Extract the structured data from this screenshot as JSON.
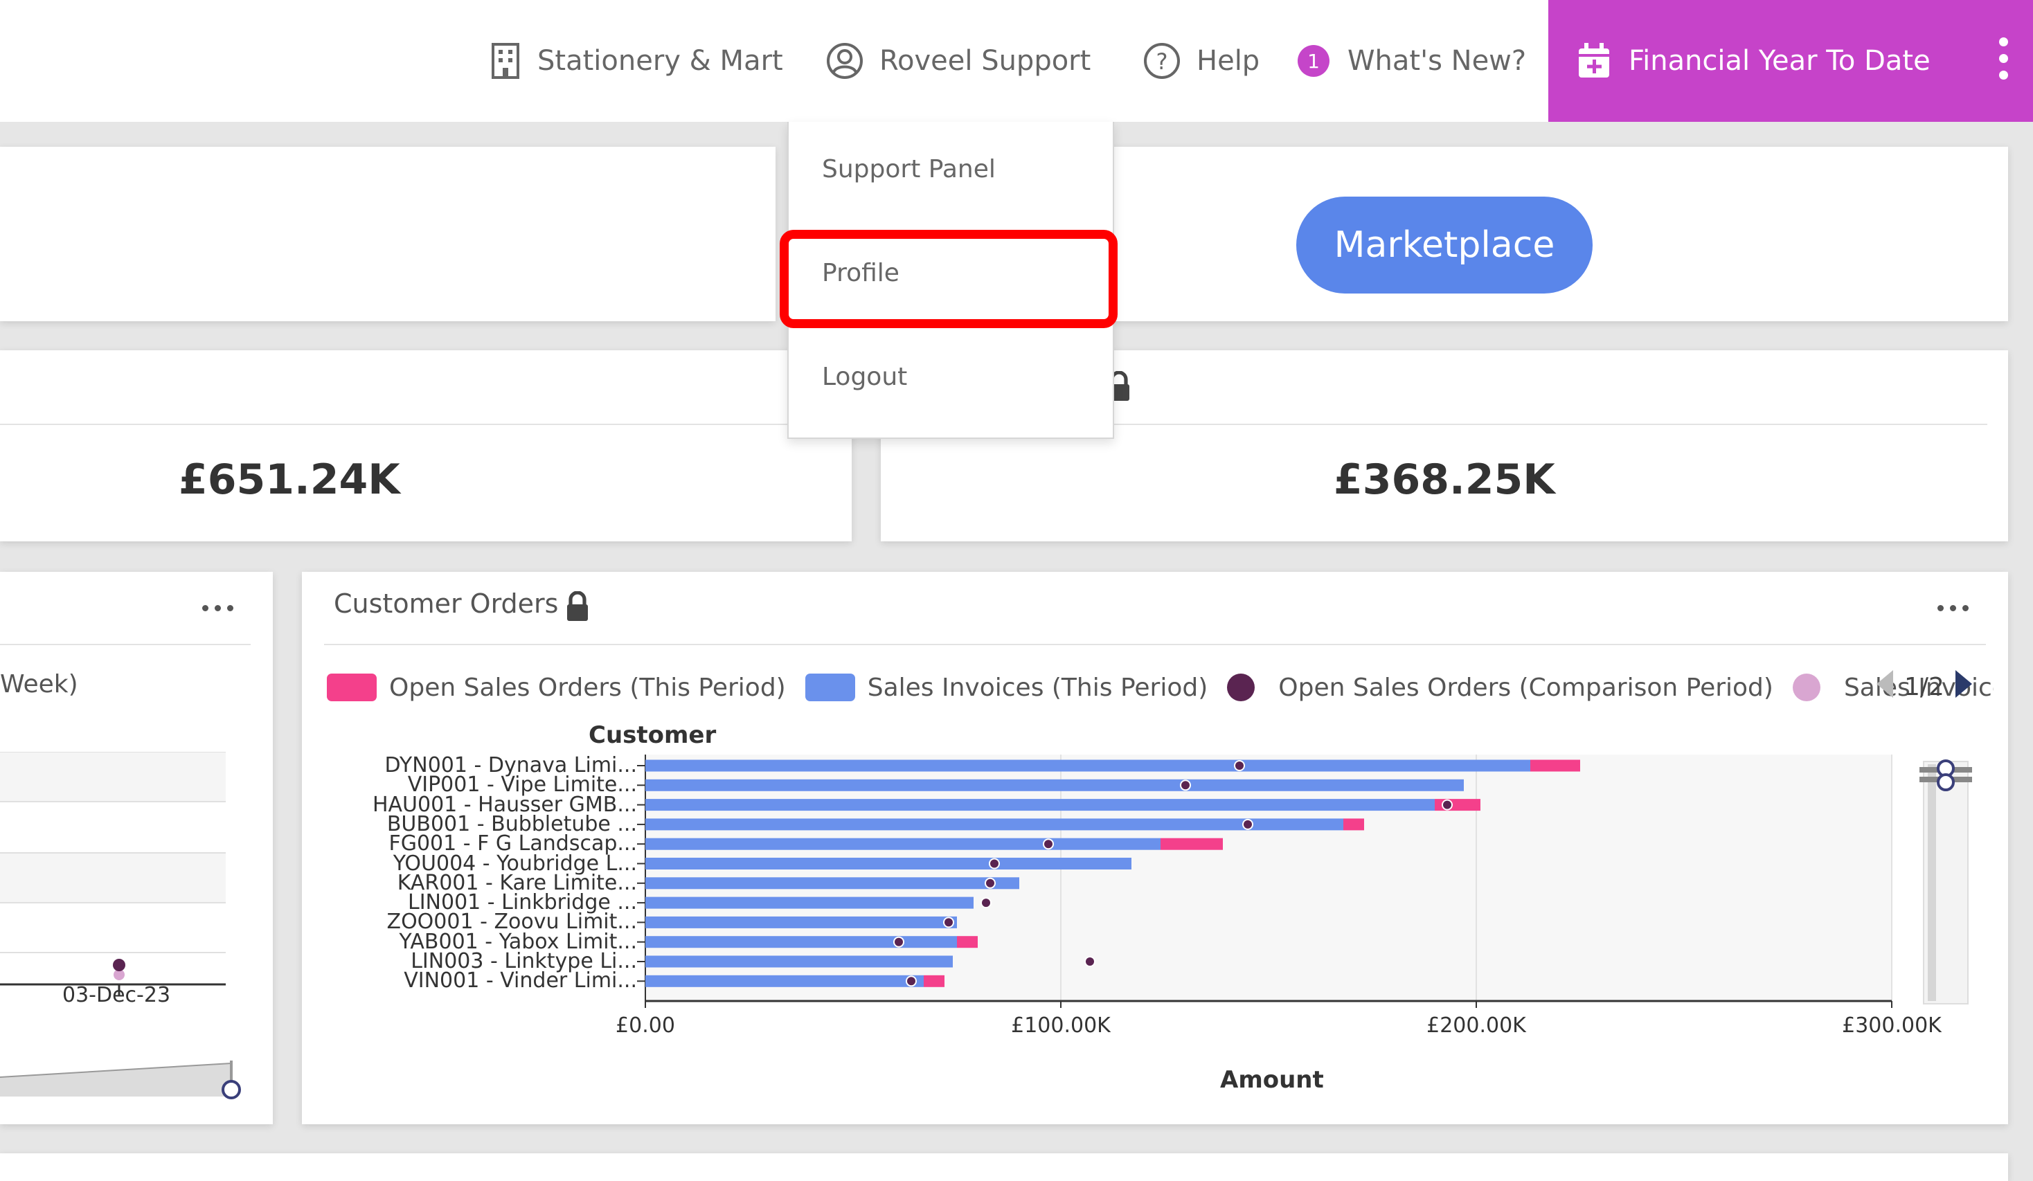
{
  "header": {
    "company": "Stationery & Mart",
    "user": "Roveel Support",
    "help": "Help",
    "whats_new_count": "1",
    "whats_new": "What's New?",
    "period": "Financial Year To Date",
    "accent_color": "#c643c9"
  },
  "user_menu": {
    "items": [
      "Support Panel",
      "Profile",
      "Logout"
    ]
  },
  "marketplace": {
    "label": "Marketplace",
    "color": "#5a86ea"
  },
  "kpis": [
    {
      "value": "£651.24K"
    },
    {
      "value": "£368.25K"
    }
  ],
  "left_panel": {
    "legend_fragment": "Week)",
    "x_tick": "03-Dec-23"
  },
  "customer_orders": {
    "title": "Customer Orders",
    "pager": "1/2",
    "legend": [
      {
        "label": "Open Sales Orders (This Period)",
        "color": "#f4408b",
        "shape": "rect"
      },
      {
        "label": "Sales Invoices (This Period)",
        "color": "#6a91ec",
        "shape": "rect"
      },
      {
        "label": "Open Sales Orders (Comparison Period)",
        "color": "#5a2451",
        "shape": "dot"
      },
      {
        "label": "Sales Invoices",
        "color": "#d9a6d1",
        "shape": "dot"
      }
    ]
  },
  "chart_data": {
    "type": "bar",
    "orientation": "horizontal",
    "stacked": true,
    "ylabel": "Customer",
    "xlabel": "Amount",
    "xlim": [
      0,
      300000
    ],
    "x_ticks": [
      "£0.00",
      "£100.00K",
      "£200.00K",
      "£300.00K"
    ],
    "categories": [
      "DYN001 - Dynava Limi...",
      "VIP001 - Vipe Limite...",
      "HAU001 - Hausser GMB...",
      "BUB001 - Bubbletube ...",
      "FG001 - F G Landscap...",
      "YOU004 - Youbridge L...",
      "KAR001 - Kare Limite...",
      "LIN001 - Linkbridge ...",
      "ZOO001 - Zoovu Limit...",
      "YAB001 - Yabox Limit...",
      "LIN003 - Linktype Li...",
      "VIN001 - Vinder Limi..."
    ],
    "series": [
      {
        "name": "Sales Invoices (This Period)",
        "color": "#6a91ec",
        "values": [
          213000,
          197000,
          190000,
          168000,
          124000,
          117000,
          90000,
          79000,
          75000,
          75000,
          74000,
          67000
        ]
      },
      {
        "name": "Open Sales Orders (This Period)",
        "color": "#f4408b",
        "values": [
          12000,
          0,
          11000,
          5000,
          15000,
          0,
          0,
          0,
          0,
          5000,
          0,
          5000
        ]
      },
      {
        "name": "Open Sales Orders (Comparison Period)",
        "color": "#5a2451",
        "type": "scatter",
        "values": [
          143000,
          130000,
          193000,
          145000,
          97000,
          84000,
          83000,
          82000,
          73000,
          61000,
          107000,
          64000
        ]
      }
    ]
  }
}
